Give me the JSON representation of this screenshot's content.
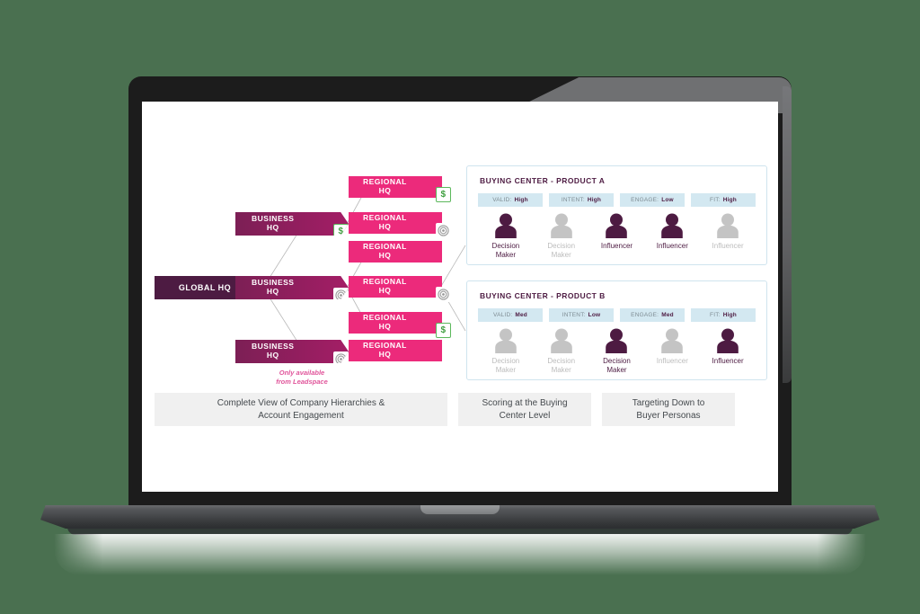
{
  "background_color": "#4a7050",
  "device": {
    "name": "laptop-mockup",
    "bezel_color": "#1c1c1c",
    "base_color": "#3d3f41",
    "screen_background": "#ffffff"
  },
  "colors": {
    "global_hq": "#4d1b42",
    "business_hq": "#a41e66",
    "regional_hq": "#ec2a7b",
    "chip_background": "#d3e8f1",
    "panel_border": "#cfe4ee",
    "person_active": "#4d1b42",
    "person_inactive": "#c4c4c4",
    "money_badge": "#3f9f3f",
    "footnote": "#e0549a",
    "caption_background": "#f0f0f0"
  },
  "hierarchy": {
    "global": {
      "label": "GLOBAL HQ",
      "badge": "none"
    },
    "business_units": [
      {
        "label": "BUSINESS HQ",
        "badge": "money-icon"
      },
      {
        "label": "BUSINESS HQ",
        "badge": "target-icon"
      },
      {
        "label": "BUSINESS HQ",
        "badge": "target-icon"
      }
    ],
    "regional_units": [
      {
        "label": "REGIONAL HQ",
        "badge": "money-icon"
      },
      {
        "label": "REGIONAL HQ",
        "badge": "target-icon"
      },
      {
        "label": "REGIONAL HQ",
        "badge": "none"
      },
      {
        "label": "REGIONAL HQ",
        "badge": "target-icon"
      },
      {
        "label": "REGIONAL HQ",
        "badge": "money-icon"
      },
      {
        "label": "REGIONAL HQ",
        "badge": "none"
      }
    ],
    "footnote": "Only available\nfrom Leadspace",
    "footnote_line1": "Only available",
    "footnote_line2": "from Leadspace"
  },
  "buying_centers": [
    {
      "title": "BUYING CENTER - PRODUCT A",
      "chips": [
        {
          "label": "VALID:",
          "value": "High"
        },
        {
          "label": "INTENT:",
          "value": "High"
        },
        {
          "label": "ENGAGE:",
          "value": "Low"
        },
        {
          "label": "FIT:",
          "value": "High"
        }
      ],
      "people": [
        {
          "role_line1": "Decision",
          "role_line2": "Maker",
          "state": "active"
        },
        {
          "role_line1": "Decision",
          "role_line2": "Maker",
          "state": "inactive"
        },
        {
          "role_line1": "Influencer",
          "role_line2": "",
          "state": "active"
        },
        {
          "role_line1": "Influencer",
          "role_line2": "",
          "state": "active"
        },
        {
          "role_line1": "Influencer",
          "role_line2": "",
          "state": "inactive"
        }
      ]
    },
    {
      "title": "BUYING CENTER - PRODUCT B",
      "chips": [
        {
          "label": "VALID:",
          "value": "Med"
        },
        {
          "label": "INTENT:",
          "value": "Low"
        },
        {
          "label": "ENGAGE:",
          "value": "Med"
        },
        {
          "label": "FIT:",
          "value": "High"
        }
      ],
      "people": [
        {
          "role_line1": "Decision",
          "role_line2": "Maker",
          "state": "inactive"
        },
        {
          "role_line1": "Decision",
          "role_line2": "Maker",
          "state": "inactive"
        },
        {
          "role_line1": "Decision",
          "role_line2": "Maker",
          "state": "active"
        },
        {
          "role_line1": "Influencer",
          "role_line2": "",
          "state": "inactive"
        },
        {
          "role_line1": "Influencer",
          "role_line2": "",
          "state": "active"
        }
      ]
    }
  ],
  "captions": [
    {
      "line1": "Complete View of Company Hierarchies &",
      "line2": "Account Engagement"
    },
    {
      "line1": "Scoring at the Buying",
      "line2": "Center Level"
    },
    {
      "line1": "Targeting Down to",
      "line2": "Buyer Personas"
    }
  ]
}
